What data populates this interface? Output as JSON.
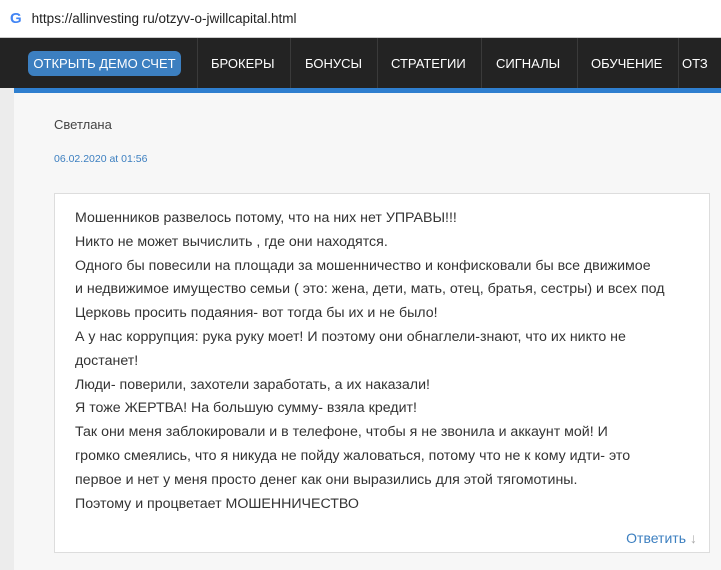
{
  "browser": {
    "url": "https://allinvesting ru/otzyv-o-jwillcapital.html"
  },
  "nav": {
    "demo": "ОТКРЫТЬ ДЕМО СЧЕТ",
    "items": [
      "БРОКЕРЫ",
      "БОНУСЫ",
      "СТРАТЕГИИ",
      "СИГНАЛЫ",
      "ОБУЧЕНИЕ",
      "ОТЗ"
    ]
  },
  "comment": {
    "author": "Светлана",
    "date": "06.02.2020 at 01:56",
    "lines": [
      "Мошенников развелось потому, что на них нет УПРАВЫ!!!",
      "Никто не может вычислить , где они находятся.",
      "Одного бы повесили на площади за мошенничество и конфисковали бы все движимое",
      "и недвижимое имущество семьи ( это: жена, дети, мать, отец, братья, сестры) и всех под",
      "Церковь просить подаяния- вот тогда бы их и не было!",
      "А у нас коррупция: рука руку моет! И поэтому они обнаглели-знают, что их никто не",
      "достанет!",
      "Люди- поверили, захотели заработать, а их наказали!",
      "Я тоже ЖЕРТВА! На большую сумму- взяла кредит!",
      "Так они меня заблокировали и в телефоне, чтобы я не звонила и аккаунт мой! И",
      "громко смеялись, что я никуда не пойду жаловаться, потому что не к кому идти- это",
      "первое и нет у меня просто денег как они выразились для этой тягомотины.",
      "Поэтому и процветает МОШЕННИЧЕСТВО"
    ],
    "reply": "Ответить"
  }
}
